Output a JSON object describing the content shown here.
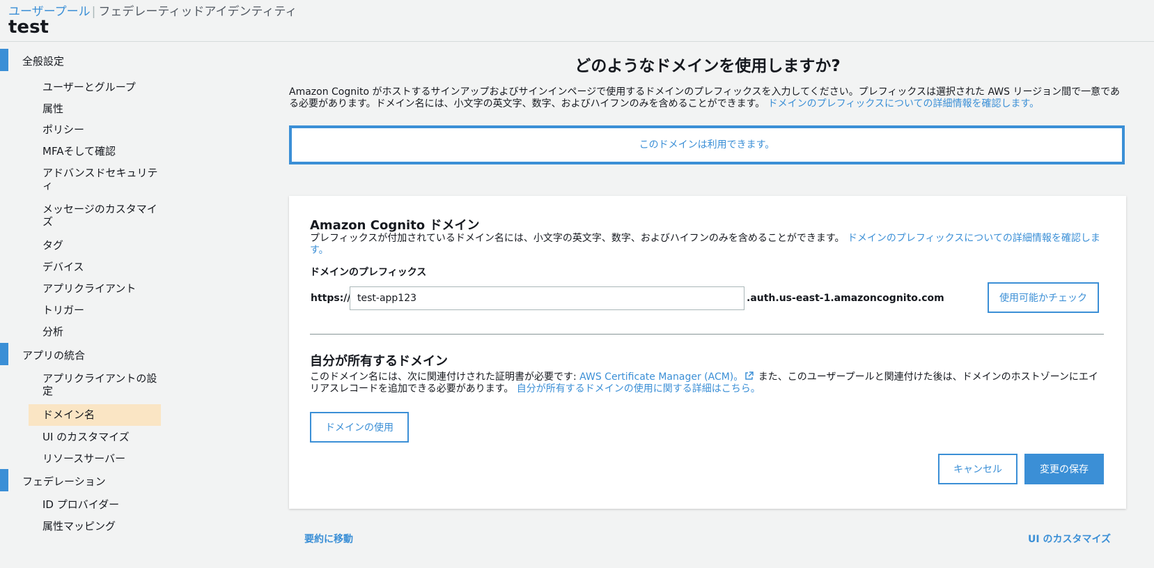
{
  "header": {
    "breadcrumb_user_pools": "ユーザープール",
    "breadcrumb_separator": "|",
    "breadcrumb_federated": "フェデレーティッドアイデンティティ",
    "pool_name": "test"
  },
  "sidebar": {
    "general": {
      "label": "全般設定",
      "items": [
        "ユーザーとグループ",
        "属性",
        "ポリシー",
        "MFAそして確認",
        "アドバンスドセキュリティ",
        "メッセージのカスタマイズ",
        "タグ",
        "デバイス",
        "アプリクライアント",
        "トリガー",
        "分析"
      ]
    },
    "app_integration": {
      "label": "アプリの統合",
      "items": [
        "アプリクライアントの設定",
        "ドメイン名",
        "UI のカスタマイズ",
        "リソースサーバー"
      ],
      "active_item": "ドメイン名"
    },
    "federation": {
      "label": "フェデレーション",
      "items": [
        "ID プロバイダー",
        "属性マッピング"
      ]
    }
  },
  "main": {
    "title": "どのようなドメインを使用しますか?",
    "intro_text": "Amazon Cognito がホストするサインアップおよびサインインページで使用するドメインのプレフィックスを入力してください。プレフィックスは選択された AWS リージョン間で一意である必要があります。ドメイン名には、小文字の英文字、数字、およびハイフンのみを含めることができます。",
    "intro_link": "ドメインのプレフィックスについての詳細情報を確認します。",
    "availability_message": "このドメインは利用できます。"
  },
  "cognito_domain": {
    "heading": "Amazon Cognito ドメイン",
    "description": "プレフィックスが付加されているドメイン名には、小文字の英文字、数字、およびハイフンのみを含めることができます。",
    "description_link": "ドメインのプレフィックスについての詳細情報を確認します。",
    "prefix_label": "ドメインのプレフィックス",
    "scheme": "https://",
    "prefix_value": "test-app123",
    "suffix": ".auth.us-east-1.amazoncognito.com",
    "check_button": "使用可能かチェック"
  },
  "own_domain": {
    "heading": "自分が所有するドメイン",
    "description_before": "このドメイン名には、次に関連付けされた証明書が必要です:",
    "acm_link": "AWS Certificate Manager (ACM)。",
    "description_after": "また、このユーザープールと関連付けた後は、ドメインのホストゾーンにエイリアスレコードを追加できる必要があります。",
    "details_link": "自分が所有するドメインの使用に関する詳細はこちら。",
    "use_button": "ドメインの使用"
  },
  "actions": {
    "cancel": "キャンセル",
    "save": "変更の保存"
  },
  "footer": {
    "go_to_summary": "要約に移動",
    "customize_ui": "UI のカスタマイズ"
  },
  "colors": {
    "accent": "#3b8fd6",
    "active_item_bg": "#fae5c4",
    "page_bg": "#f2f3f3"
  }
}
